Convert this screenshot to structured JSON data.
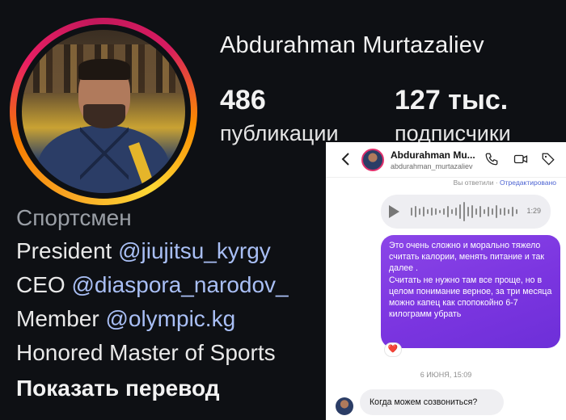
{
  "profile": {
    "name": "Abdurahman Murtazaliev",
    "posts_count": "486",
    "posts_label": "публикации",
    "followers_count": "127 тыс.",
    "followers_label": "подписчики",
    "category": "Спортсмен",
    "bio": [
      {
        "prefix": "President ",
        "link": "@jiujitsu_kyrgy"
      },
      {
        "prefix": "CEO ",
        "link": "@diaspora_narodov_"
      },
      {
        "prefix": "Member ",
        "link": "@olympic.kg"
      }
    ],
    "honor_line": "Honored Master of Sports",
    "translate_label": "Показать перевод"
  },
  "dm": {
    "contact_name": "Abdurahman Mu...",
    "contact_username": "abdurahman_murtazaliev",
    "icons": [
      "back-chevron-icon",
      "phone-icon",
      "video-camera-icon",
      "tag-icon"
    ],
    "replied_label": "Вы ответили",
    "separator": "·",
    "edited_label": "Отредактировано",
    "voice_duration": "1:29",
    "outgoing_message": [
      "Это очень сложно и морально тяжело считать калории, менять питание и так далее .",
      "Считать не нужно  там все проще, но в целом понимание верное, за три месяца можно капец как спопокойно 6-7 килограмм убрать"
    ],
    "reaction": "❤️",
    "date_divider": "6 ИЮНЯ, 15:09",
    "incoming_message": "Когда можем созвониться?"
  },
  "colors": {
    "accent_purple": "#7b35e0",
    "link_blue": "#a9bff5",
    "edited_blue": "#4c63d2"
  }
}
